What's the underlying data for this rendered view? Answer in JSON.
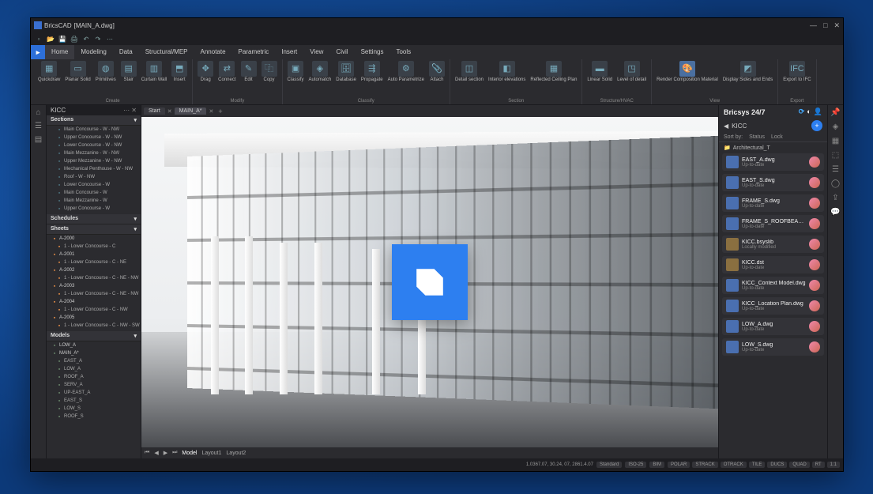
{
  "titlebar": {
    "appname": "BricsCAD",
    "doc": "[MAIN_A.dwg]"
  },
  "menus": [
    "Home",
    "Modeling",
    "Data",
    "Structural/MEP",
    "Annotate",
    "Parametric",
    "Insert",
    "View",
    "Civil",
    "Settings",
    "Tools"
  ],
  "ribbon_groups": [
    {
      "label": "Create",
      "tools": [
        {
          "n": "Quickdraw",
          "g": "▦"
        },
        {
          "n": "Planar Solid",
          "g": "▭"
        },
        {
          "n": "Primitives",
          "g": "◍"
        },
        {
          "n": "Stair",
          "g": "▤"
        },
        {
          "n": "Curtain Wall",
          "g": "▥"
        },
        {
          "n": "Insert",
          "g": "⬒"
        }
      ]
    },
    {
      "label": "Modify",
      "tools": [
        {
          "n": "Drag",
          "g": "✥"
        },
        {
          "n": "Connect",
          "g": "⇄"
        },
        {
          "n": "Edit",
          "g": "✎"
        },
        {
          "n": "Copy",
          "g": "⿻"
        }
      ]
    },
    {
      "label": "Classify",
      "tools": [
        {
          "n": "Classify",
          "g": "▣"
        },
        {
          "n": "Automatch",
          "g": "◈"
        },
        {
          "n": "Database",
          "g": "🗄"
        },
        {
          "n": "Propagate",
          "g": "⇶"
        },
        {
          "n": "Auto Parametrize",
          "g": "⚙"
        },
        {
          "n": "Attach",
          "g": "📎"
        }
      ]
    },
    {
      "label": "Section",
      "tools": [
        {
          "n": "Detail section",
          "g": "◫"
        },
        {
          "n": "Interior elevations",
          "g": "◧"
        },
        {
          "n": "Reflected Ceiling Plan",
          "g": "▦"
        }
      ]
    },
    {
      "label": "Structure/HVAC",
      "tools": [
        {
          "n": "Linear Solid",
          "g": "▬"
        },
        {
          "n": "Level of detail",
          "g": "◳"
        }
      ]
    },
    {
      "label": "View",
      "tools": [
        {
          "n": "Render Composition Material",
          "g": "🎨",
          "hl": true
        },
        {
          "n": "Display Sides and Ends",
          "g": "◩"
        }
      ]
    },
    {
      "label": "Export",
      "tools": [
        {
          "n": "Export to IFC",
          "g": "IFC"
        }
      ]
    }
  ],
  "left_panel": {
    "title": "KICC",
    "sections": {
      "hdr": "Sections",
      "items": [
        "Main Concourse - W - NW",
        "Upper Concourse - W - NW",
        "Lower Concourse - W - NW",
        "Main Mezzanine - W - NW",
        "Upper Mezzanine - W - NW",
        "Mechanical Penthouse - W - NW",
        "Roof - W - NW",
        "Lower Concourse - W",
        "Main Concourse - W",
        "Main Mezzanine - W",
        "Upper Concourse - W"
      ]
    },
    "schedules": {
      "hdr": "Schedules"
    },
    "sheets": {
      "hdr": "Sheets",
      "items": [
        {
          "n": "A-2000",
          "p": true
        },
        {
          "n": "1 - Lower Concourse - C"
        },
        {
          "n": "A-2001",
          "p": true
        },
        {
          "n": "1 - Lower Concourse - C - NE"
        },
        {
          "n": "A-2002",
          "p": true
        },
        {
          "n": "1 - Lower Concourse - C - NE - NW"
        },
        {
          "n": "A-2003",
          "p": true
        },
        {
          "n": "1 - Lower Concourse - C - NE - NW"
        },
        {
          "n": "A-2004",
          "p": true
        },
        {
          "n": "1 - Lower Concourse - C - NW"
        },
        {
          "n": "A-2005",
          "p": true
        },
        {
          "n": "1 - Lower Concourse - C - NW - SW"
        }
      ]
    },
    "models": {
      "hdr": "Models",
      "items": [
        {
          "n": "LOW_A",
          "p": true
        },
        {
          "n": "MAIN_A*",
          "p": true,
          "exp": true
        },
        {
          "n": "EAST_A"
        },
        {
          "n": "LOW_A"
        },
        {
          "n": "ROOF_A"
        },
        {
          "n": "SERV_A"
        },
        {
          "n": "UP-EAST_A"
        },
        {
          "n": "EAST_S"
        },
        {
          "n": "LOW_S"
        },
        {
          "n": "ROOF_S"
        }
      ]
    }
  },
  "tabs": {
    "items": [
      "Start",
      "MAIN_A*"
    ],
    "active": 1
  },
  "viewport_tabs": {
    "items": [
      "Model",
      "Layout1",
      "Layout2"
    ],
    "active": 0
  },
  "right_panel": {
    "title": "Bricsys 24/7",
    "crumb": "KICC",
    "sort_labels": [
      "Sort by:",
      "Status",
      "Lock"
    ],
    "folder": "Architectural_T",
    "files": [
      {
        "n": "EAST_A.dwg",
        "s": "Up-to-date",
        "t": "dwg"
      },
      {
        "n": "EAST_S.dwg",
        "s": "Up-to-date",
        "t": "dwg"
      },
      {
        "n": "FRAME_S.dwg",
        "s": "Up-to-date",
        "t": "dwg"
      },
      {
        "n": "FRAME_S_ROOFBEAM.dwg",
        "s": "Up-to-date",
        "t": "dwg"
      },
      {
        "n": "KICC.bsyslib",
        "s": "Locally modified",
        "t": "doc"
      },
      {
        "n": "KICC.dst",
        "s": "Up-to-date",
        "t": "doc"
      },
      {
        "n": "KICC_Context Model.dwg",
        "s": "Up-to-date",
        "t": "dwg"
      },
      {
        "n": "KICC_Location Plan.dwg",
        "s": "Up-to-date",
        "t": "dwg"
      },
      {
        "n": "LOW_A.dwg",
        "s": "Up-to-date",
        "t": "dwg"
      },
      {
        "n": "LOW_S.dwg",
        "s": "Up-to-date",
        "t": "dwg"
      }
    ]
  },
  "statusbar": {
    "coords": "1.0367.07, 30.24, 07, 2861.4.07",
    "std": "Standard",
    "iso": "ISO-25",
    "bim": "BIM",
    "toggles": [
      "POLAR",
      "STRACK",
      "OTRACK",
      "TILE",
      "DUCS",
      "QUAD",
      "RT",
      "1:1"
    ]
  }
}
